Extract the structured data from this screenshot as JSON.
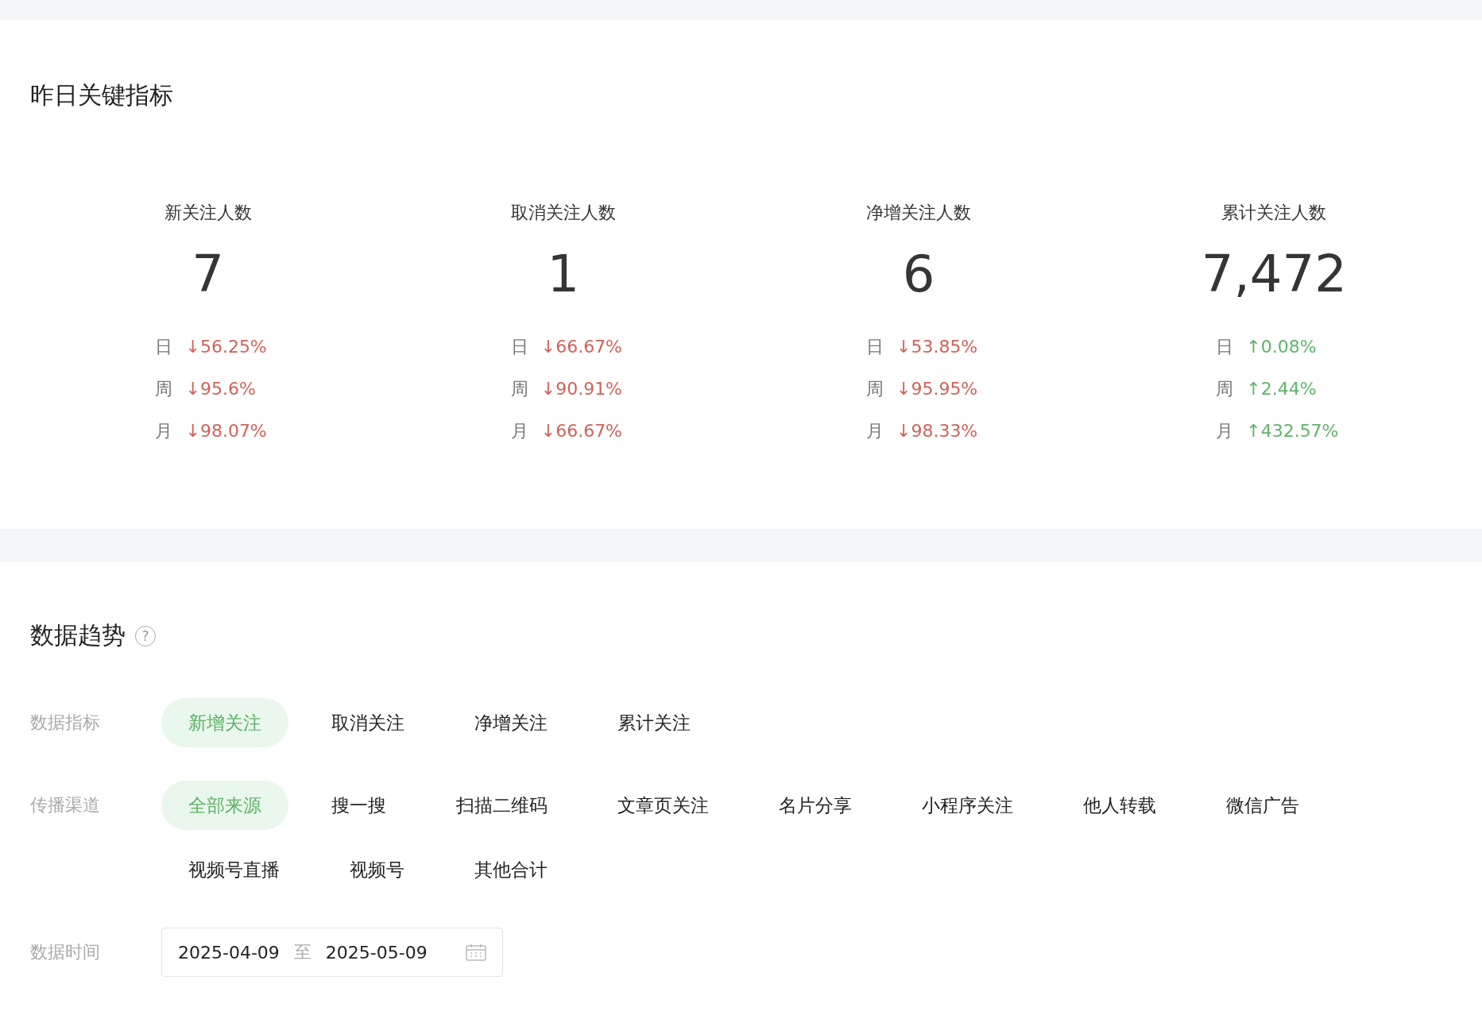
{
  "key_metrics": {
    "title": "昨日关键指标",
    "metrics": [
      {
        "label": "新关注人数",
        "value": "7",
        "changes": [
          {
            "period": "日",
            "kind": "down",
            "arrow": "↓",
            "value": "56.25%"
          },
          {
            "period": "周",
            "kind": "down",
            "arrow": "↓",
            "value": "95.6%"
          },
          {
            "period": "月",
            "kind": "down",
            "arrow": "↓",
            "value": "98.07%"
          }
        ]
      },
      {
        "label": "取消关注人数",
        "value": "1",
        "changes": [
          {
            "period": "日",
            "kind": "down",
            "arrow": "↓",
            "value": "66.67%"
          },
          {
            "period": "周",
            "kind": "down",
            "arrow": "↓",
            "value": "90.91%"
          },
          {
            "period": "月",
            "kind": "down",
            "arrow": "↓",
            "value": "66.67%"
          }
        ]
      },
      {
        "label": "净增关注人数",
        "value": "6",
        "changes": [
          {
            "period": "日",
            "kind": "down",
            "arrow": "↓",
            "value": "53.85%"
          },
          {
            "period": "周",
            "kind": "down",
            "arrow": "↓",
            "value": "95.95%"
          },
          {
            "period": "月",
            "kind": "down",
            "arrow": "↓",
            "value": "98.33%"
          }
        ]
      },
      {
        "label": "累计关注人数",
        "value": "7,472",
        "changes": [
          {
            "period": "日",
            "kind": "up",
            "arrow": "↑",
            "value": "0.08%"
          },
          {
            "period": "周",
            "kind": "up",
            "arrow": "↑",
            "value": "2.44%"
          },
          {
            "period": "月",
            "kind": "up",
            "arrow": "↑",
            "value": "432.57%"
          }
        ]
      }
    ]
  },
  "trend": {
    "title": "数据趋势",
    "help": "?",
    "filters": [
      {
        "label": "数据指标",
        "options": [
          {
            "label": "新增关注",
            "selected": true
          },
          {
            "label": "取消关注",
            "selected": false
          },
          {
            "label": "净增关注",
            "selected": false
          },
          {
            "label": "累计关注",
            "selected": false
          }
        ]
      },
      {
        "label": "传播渠道",
        "options": [
          {
            "label": "全部来源",
            "selected": true
          },
          {
            "label": "搜一搜",
            "selected": false
          },
          {
            "label": "扫描二维码",
            "selected": false
          },
          {
            "label": "文章页关注",
            "selected": false
          },
          {
            "label": "名片分享",
            "selected": false
          },
          {
            "label": "小程序关注",
            "selected": false
          },
          {
            "label": "他人转载",
            "selected": false
          },
          {
            "label": "微信广告",
            "selected": false
          },
          {
            "label": "视频号直播",
            "selected": false
          },
          {
            "label": "视频号",
            "selected": false
          },
          {
            "label": "其他合计",
            "selected": false
          }
        ]
      }
    ],
    "date": {
      "label": "数据时间",
      "start": "2025-04-09",
      "separator": "至",
      "end": "2025-05-09"
    }
  }
}
